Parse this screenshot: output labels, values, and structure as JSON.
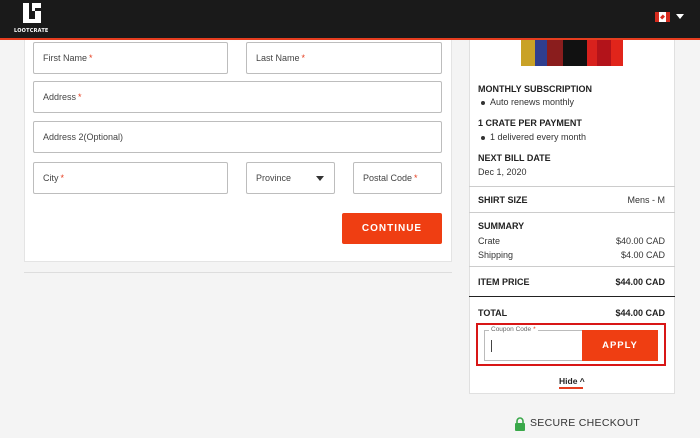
{
  "header": {
    "logo_text": "LOOTCRATE",
    "colors": {
      "bar": "#1a1a1a",
      "accent": "#e63d1f"
    },
    "locale_flag": "canada-flag-icon"
  },
  "form": {
    "required_mark": "*",
    "first_name": {
      "placeholder": "First Name"
    },
    "last_name": {
      "placeholder": "Last Name"
    },
    "address": {
      "placeholder": "Address"
    },
    "address2": {
      "placeholder": "Address 2(Optional)"
    },
    "city": {
      "placeholder": "City"
    },
    "province": {
      "selected": "Province"
    },
    "postal_code": {
      "placeholder": "Postal Code"
    },
    "continue_label": "CONTINUE",
    "button_color": "#ef3e12"
  },
  "summary": {
    "monthly_subscription": {
      "title": "MONTHLY SUBSCRIPTION",
      "detail": "Auto renews monthly"
    },
    "crates_per_payment": {
      "title": "1 CRATE PER PAYMENT",
      "detail": "1 delivered every month"
    },
    "next_bill": {
      "title": "NEXT BILL DATE",
      "date": "Dec 1, 2020"
    },
    "shirt_size": {
      "label": "SHIRT SIZE",
      "value": "Mens - M"
    },
    "breakdown": {
      "title": "SUMMARY",
      "crate_label": "Crate",
      "crate_value": "$40.00 CAD",
      "shipping_label": "Shipping",
      "shipping_value": "$4.00 CAD"
    },
    "item_price": {
      "label": "ITEM PRICE",
      "value": "$44.00 CAD"
    },
    "total": {
      "label": "TOTAL",
      "value": "$44.00 CAD"
    },
    "coupon": {
      "label": "Coupon Code",
      "value": "",
      "apply_label": "APPLY",
      "highlight_color": "#d81616"
    },
    "hide_label": "Hide"
  },
  "footer": {
    "secure_label": "SECURE CHECKOUT",
    "lock_color": "#3aa84a"
  }
}
